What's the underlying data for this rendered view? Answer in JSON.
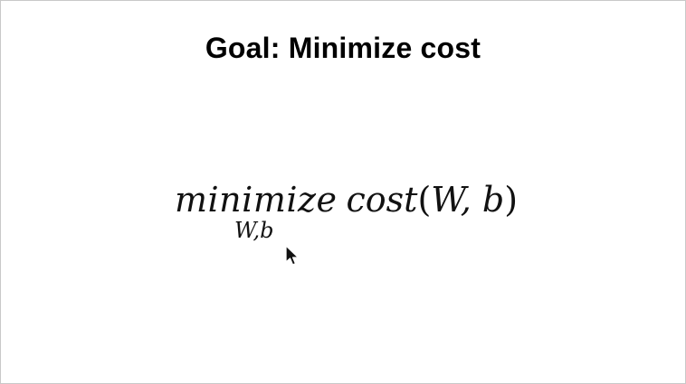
{
  "slide": {
    "title": "Goal: Minimize cost",
    "formula": {
      "operator": "minimize",
      "subscript": "W,b",
      "function": "cost",
      "open_paren": "(",
      "arguments": "W, b",
      "close_paren": ")"
    }
  },
  "pointer": {
    "icon": "mouse-pointer-icon"
  }
}
